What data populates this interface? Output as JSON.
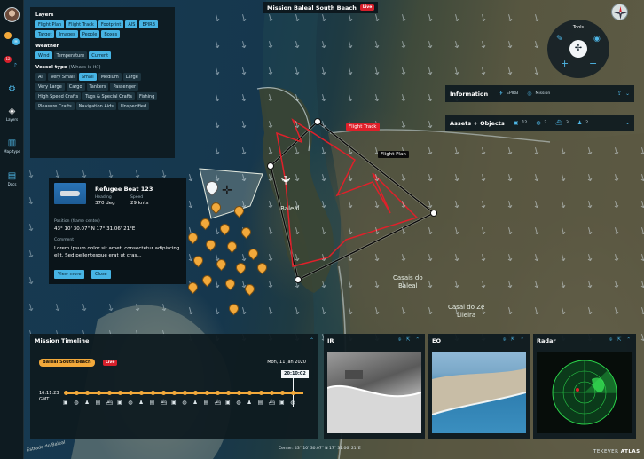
{
  "app": {
    "title": "Mission Baleal South Beach",
    "live": "Live",
    "brand_prefix": "TEKEVER",
    "brand_name": "ATLAS",
    "center_coord": "Center: 43° 10' 30.07\" N 17° 31.06' 21°E"
  },
  "rail": {
    "notif_count": "12",
    "layers_label": "Layers",
    "map_type_label": "Map type",
    "docs_label": "Docs"
  },
  "layers_panel": {
    "layers_title": "Layers",
    "layers": [
      {
        "label": "Flight Plan",
        "on": true
      },
      {
        "label": "Flight Track",
        "on": true
      },
      {
        "label": "Footprint",
        "on": true
      },
      {
        "label": "AIS",
        "on": true
      },
      {
        "label": "EPIRB",
        "on": true
      },
      {
        "label": "Target",
        "on": true
      },
      {
        "label": "Images",
        "on": true
      },
      {
        "label": "People",
        "on": true
      },
      {
        "label": "Boxes",
        "on": true
      }
    ],
    "weather_title": "Weather",
    "weather": [
      {
        "label": "Wind",
        "on": true
      },
      {
        "label": "Temperature",
        "on": false
      },
      {
        "label": "Current",
        "on": true
      }
    ],
    "vessel_title": "Vessel type",
    "vessel_sub": "(Whats is it?)",
    "vessels": [
      {
        "label": "All",
        "on": false
      },
      {
        "label": "Very Small",
        "on": false
      },
      {
        "label": "Small",
        "on": true
      },
      {
        "label": "Medium",
        "on": false
      },
      {
        "label": "Large",
        "on": false
      },
      {
        "label": "Very Large",
        "on": false
      },
      {
        "label": "Cargo",
        "on": false
      },
      {
        "label": "Tankers",
        "on": false
      },
      {
        "label": "Passenger",
        "on": false
      },
      {
        "label": "High Speed Crafts",
        "on": false
      },
      {
        "label": "Tugs & Special Crafts",
        "on": false
      },
      {
        "label": "Fishing",
        "on": false
      },
      {
        "label": "Pleasure Crafts",
        "on": false
      },
      {
        "label": "Navigation Aids",
        "on": false
      },
      {
        "label": "Unspecified",
        "on": false
      }
    ]
  },
  "tools": {
    "label": "Tools"
  },
  "info_panel": {
    "title": "Information",
    "epirb": "EPIRB",
    "mission": "Mission"
  },
  "assets_panel": {
    "title": "Assets + Objects",
    "count1": "12",
    "count2": "2",
    "count3": "3",
    "count4": "2"
  },
  "map_labels": {
    "flight_track": "Flight Track",
    "flight_plan": "Flight Plan",
    "baleal": "Baleal",
    "casais_do": "Casais do",
    "casais_baleal": "Baleal",
    "casal_do_ze": "Casal do Zé",
    "lileira": "Lileira",
    "estrada": "Estrada do Baleal"
  },
  "popup": {
    "name": "Refugee Boat 123",
    "heading_label": "Heading",
    "heading_value": "370 deg",
    "speed_label": "Speed",
    "speed_value": "29 knts",
    "position_label": "Position (frame center)",
    "position_value": "43° 10' 30.07\" N 17° 31.06' 21°E",
    "comment_label": "Comment",
    "comment_text": "Lorem ipsum dolor sit amet, consectetur adipiscing elit. Sed pellentesque erat ut cras...",
    "view_more": "View more",
    "close": "Close"
  },
  "timeline": {
    "title": "Mission Timeline",
    "mission_tag": "Baleal South Beach",
    "live": "Live",
    "date": "Mon, 11 Jan 2020",
    "cursor_time": "20:10:02",
    "start_time": "16:11:23",
    "start_zone": "GMT"
  },
  "feeds": {
    "ir": "IR",
    "eo": "EO",
    "radar": "Radar"
  },
  "colors": {
    "accent": "#47b4e4",
    "live": "#d6202b",
    "track": "#e0202a",
    "marker": "#f2a93b"
  }
}
